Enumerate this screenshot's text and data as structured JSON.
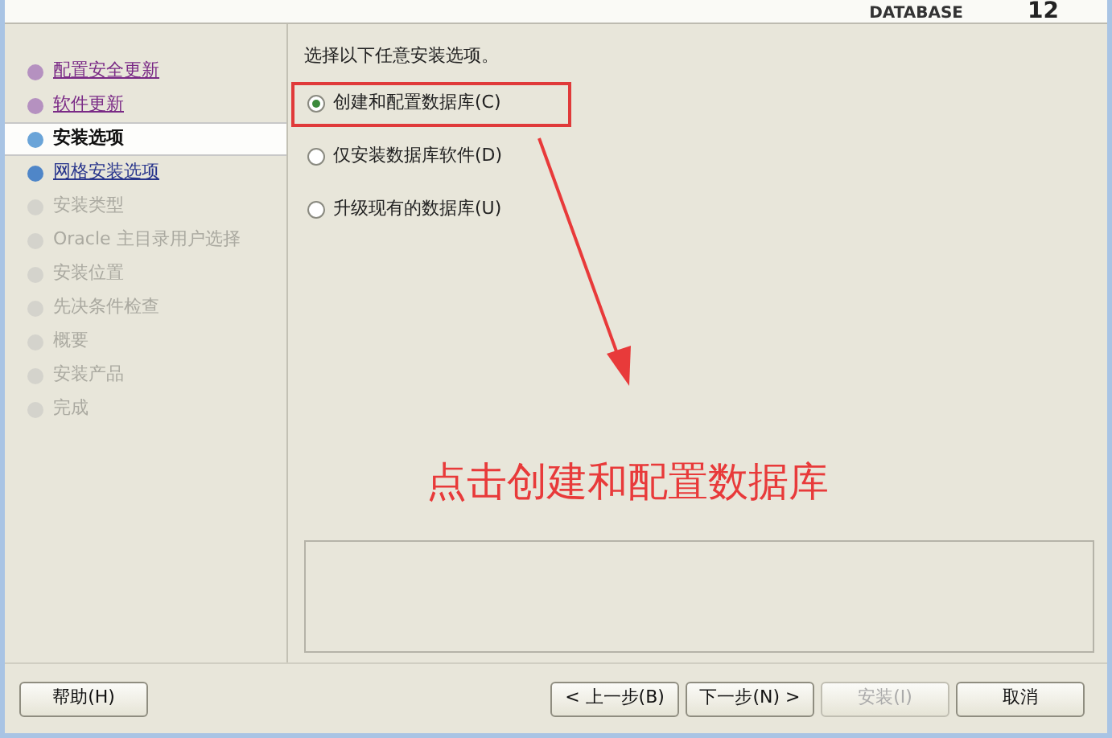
{
  "banner": {
    "product": "DATABASE",
    "version": "12"
  },
  "steps": [
    {
      "label": "配置安全更新",
      "kind": "visited",
      "selected": false
    },
    {
      "label": "软件更新",
      "kind": "visited",
      "selected": false
    },
    {
      "label": "安装选项",
      "kind": "current",
      "selected": true
    },
    {
      "label": "网格安装选项",
      "kind": "link",
      "selected": false
    },
    {
      "label": "安装类型",
      "kind": "pending",
      "selected": false
    },
    {
      "label": "Oracle 主目录用户选择",
      "kind": "pending",
      "selected": false
    },
    {
      "label": "安装位置",
      "kind": "pending",
      "selected": false
    },
    {
      "label": "先决条件检查",
      "kind": "pending",
      "selected": false
    },
    {
      "label": "概要",
      "kind": "pending",
      "selected": false
    },
    {
      "label": "安装产品",
      "kind": "pending",
      "selected": false
    },
    {
      "label": "完成",
      "kind": "pending",
      "selected": false
    }
  ],
  "prompt": "选择以下任意安装选项。",
  "options": [
    {
      "label": "创建和配置数据库(C)",
      "selected": true,
      "highlighted": true
    },
    {
      "label": "仅安装数据库软件(D)",
      "selected": false,
      "highlighted": false
    },
    {
      "label": "升级现有的数据库(U)",
      "selected": false,
      "highlighted": false
    }
  ],
  "annotation": "点击创建和配置数据库",
  "help_button": {
    "label": "帮助(H)"
  },
  "buttons": [
    {
      "label": "< 上一步(B)",
      "disabled": false
    },
    {
      "label": "下一步(N) >",
      "disabled": false
    },
    {
      "label": "安装(I)",
      "disabled": true
    },
    {
      "label": "取消",
      "disabled": false
    }
  ]
}
